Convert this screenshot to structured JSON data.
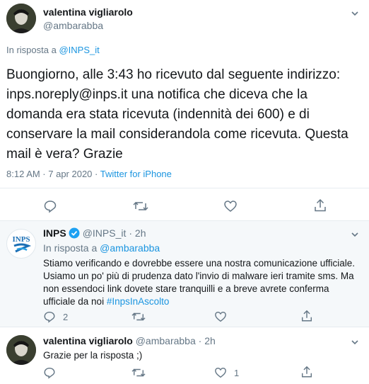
{
  "main_tweet": {
    "author_name": "valentina vigliarolo",
    "author_handle": "@ambarabba",
    "reply_prefix": "In risposta a",
    "reply_to": "@INPS_it",
    "text": "Buongiorno, alle 3:43 ho ricevuto dal seguente indirizzo: inps.noreply@inps.it una notifica che diceva che la domanda era stata ricevuta (indennità dei 600) e di conservare la mail considerandola come ricevuta. Questa mail è vera? Grazie",
    "time": "8:12 AM · 7 apr 2020 · ",
    "client": "Twitter for iPhone",
    "menu_icon": "chevron-down-icon"
  },
  "reply_1": {
    "author_name": "INPS",
    "verified": true,
    "author_handle": "@INPS_it",
    "age": "· 2h",
    "reply_prefix": "In risposta a",
    "reply_to": "@ambarabba",
    "text": "Stiamo verificando e dovrebbe essere una nostra comunicazione ufficiale. Usiamo un po' più di prudenza dato l'invio di malware ieri tramite sms. Ma non essendoci link dovete stare tranquilli e a breve avrete conferma ufficiale da noi ",
    "hashtag": "#InpsInAscolto",
    "reply_count": "2",
    "avatar_label": "INPS"
  },
  "reply_2": {
    "author_name": "valentina vigliarolo",
    "author_handle": "@ambarabba",
    "age": "· 2h",
    "text": "Grazie per la risposta ;)",
    "like_count": "1"
  },
  "colors": {
    "accent": "#1b95e0",
    "muted": "#657786",
    "highlight_bg": "#f5f8fa",
    "divider": "#e6ecf0"
  }
}
